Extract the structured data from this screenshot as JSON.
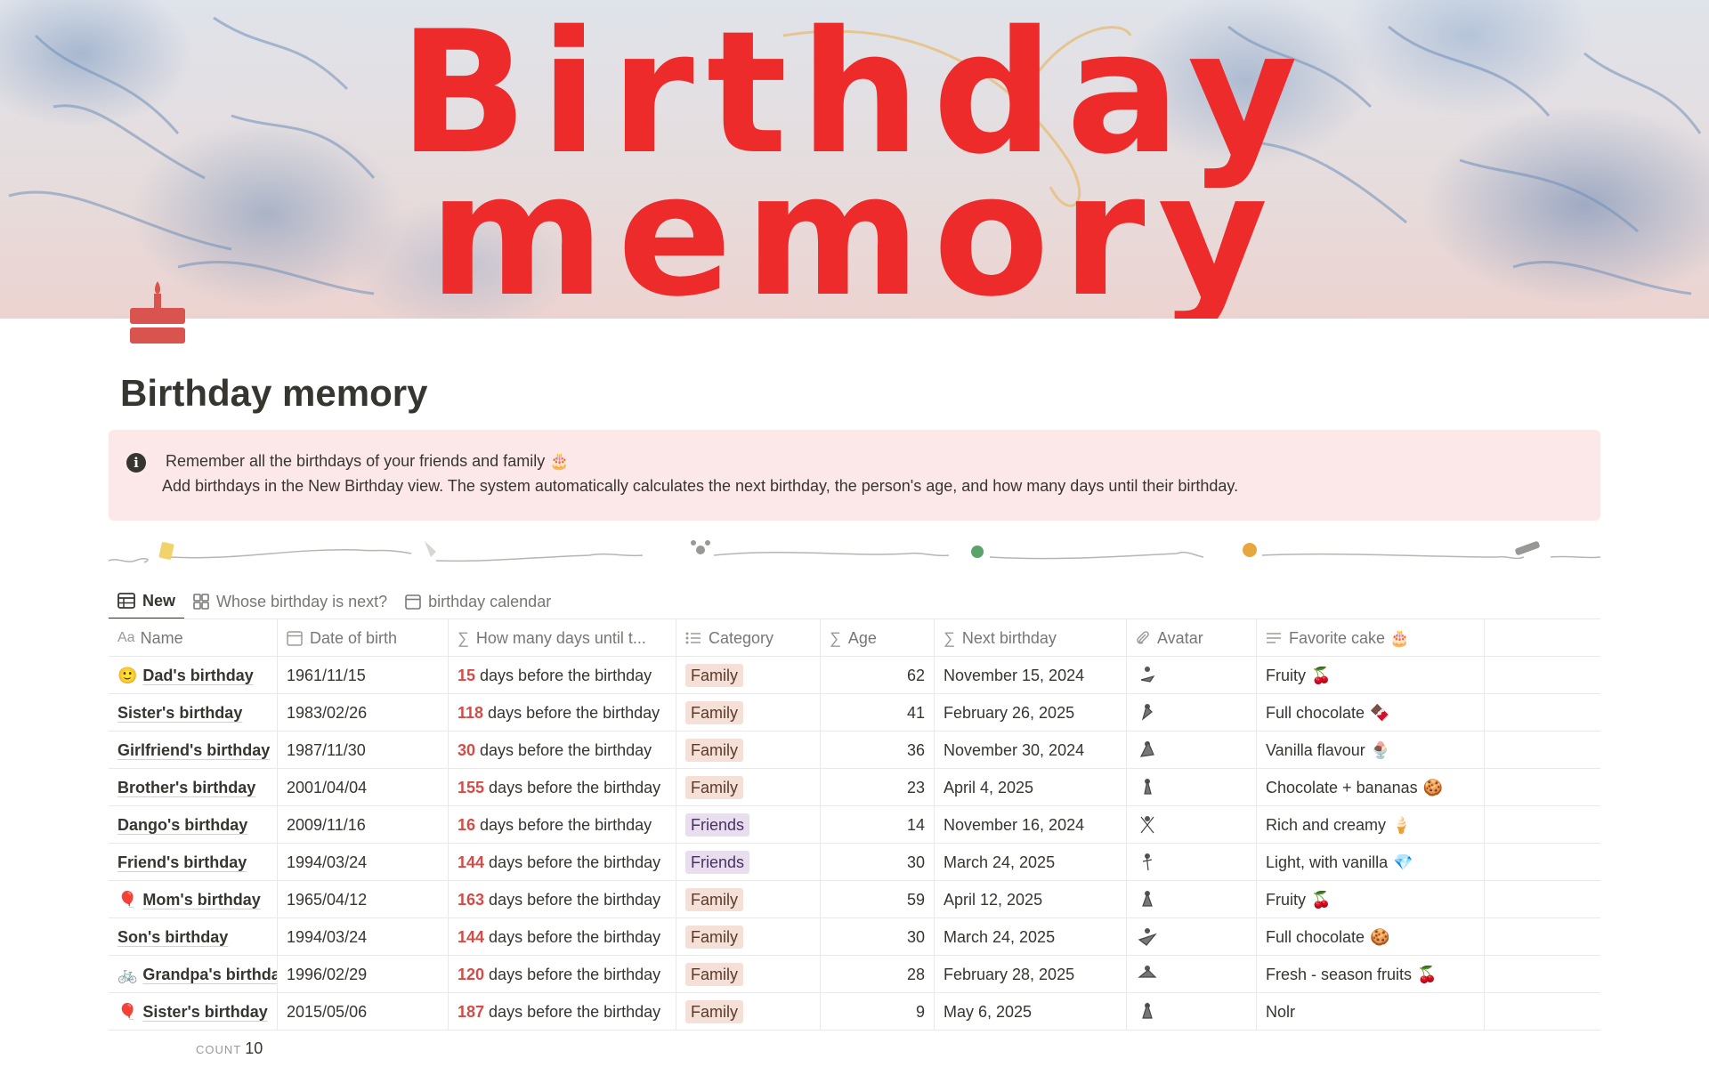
{
  "cover": {
    "title_line1": "Birthday",
    "title_line2": "memory"
  },
  "page": {
    "title": "Birthday memory",
    "icon": "cake-icon"
  },
  "callout": {
    "icon": "info-icon",
    "line1": "Remember all the birthdays of your friends and family 🎂",
    "line2": "Add birthdays in the New Birthday view. The system automatically calculates the next birthday, the person's age, and how many days until their birthday."
  },
  "tabs": [
    {
      "label": "New",
      "icon": "table-icon",
      "active": true
    },
    {
      "label": "Whose birthday is next?",
      "icon": "gallery-icon",
      "active": false
    },
    {
      "label": "birthday calendar",
      "icon": "calendar-icon",
      "active": false
    }
  ],
  "columns": [
    {
      "label": "Name",
      "icon": "text-aa-icon"
    },
    {
      "label": "Date of birth",
      "icon": "calendar-icon"
    },
    {
      "label": "How many days until t...",
      "icon": "formula-icon"
    },
    {
      "label": "Category",
      "icon": "list-icon"
    },
    {
      "label": "Age",
      "icon": "formula-icon"
    },
    {
      "label": "Next birthday",
      "icon": "formula-icon"
    },
    {
      "label": "Avatar",
      "icon": "paperclip-icon"
    },
    {
      "label": "Favorite cake 🎂",
      "icon": "text-lines-icon"
    }
  ],
  "days_suffix": "days before the birthday",
  "colors": {
    "family_bg": "#f5e0d7",
    "family_fg": "#5b3a29",
    "friends_bg": "#e8deee",
    "friends_fg": "#492f64",
    "days": "#d44c47",
    "callout_bg": "#fce8e8",
    "cover_title": "#ee2b2b"
  },
  "rows": [
    {
      "emoji": "🙂",
      "name": "Dad's birthday",
      "dob": "1961/11/15",
      "days": "15",
      "category": "Family",
      "age": "62",
      "next": "November 15, 2024",
      "cake": "Fruity",
      "cake_emoji": "🍒"
    },
    {
      "emoji": "",
      "name": "Sister's birthday",
      "dob": "1983/02/26",
      "days": "118",
      "category": "Family",
      "age": "41",
      "next": "February 26, 2025",
      "cake": "Full chocolate",
      "cake_emoji": "🍫"
    },
    {
      "emoji": "",
      "name": "Girlfriend's birthday",
      "dob": "1987/11/30",
      "days": "30",
      "category": "Family",
      "age": "36",
      "next": "November 30, 2024",
      "cake": "Vanilla flavour",
      "cake_emoji": "🍨"
    },
    {
      "emoji": "",
      "name": "Brother's birthday",
      "dob": "2001/04/04",
      "days": "155",
      "category": "Family",
      "age": "23",
      "next": "April 4, 2025",
      "cake": "Chocolate + bananas",
      "cake_emoji": "🍪"
    },
    {
      "emoji": "",
      "name": "Dango's birthday",
      "dob": "2009/11/16",
      "days": "16",
      "category": "Friends",
      "age": "14",
      "next": "November 16, 2024",
      "cake": "Rich and creamy",
      "cake_emoji": "🍦"
    },
    {
      "emoji": "",
      "name": "Friend's birthday",
      "dob": "1994/03/24",
      "days": "144",
      "category": "Friends",
      "age": "30",
      "next": "March 24, 2025",
      "cake": "Light, with vanilla",
      "cake_emoji": "💎"
    },
    {
      "emoji": "🎈",
      "name": "Mom's birthday",
      "dob": "1965/04/12",
      "days": "163",
      "category": "Family",
      "age": "59",
      "next": "April 12, 2025",
      "cake": "Fruity",
      "cake_emoji": "🍒"
    },
    {
      "emoji": "",
      "name": "Son's birthday",
      "dob": "1994/03/24",
      "days": "144",
      "category": "Family",
      "age": "30",
      "next": "March 24, 2025",
      "cake": "Full chocolate",
      "cake_emoji": "🍪"
    },
    {
      "emoji": "🚲",
      "name": "Grandpa's birthday",
      "dob": "1996/02/29",
      "days": "120",
      "category": "Family",
      "age": "28",
      "next": "February 28, 2025",
      "cake": "Fresh - season fruits",
      "cake_emoji": "🍒"
    },
    {
      "emoji": "🎈",
      "name": "Sister's birthday",
      "dob": "2015/05/06",
      "days": "187",
      "category": "Family",
      "age": "9",
      "next": "May 6, 2025",
      "cake": "Nolr",
      "cake_emoji": ""
    }
  ],
  "footer": {
    "count_label": "COUNT",
    "count_value": "10"
  }
}
